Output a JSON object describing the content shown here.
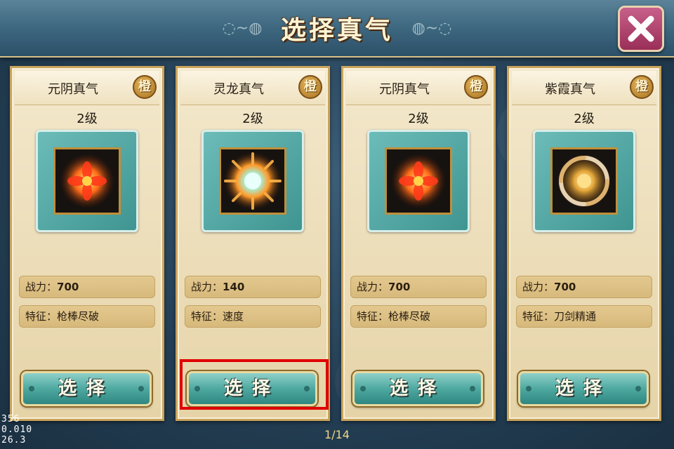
{
  "header": {
    "title": "选择真气"
  },
  "cards": [
    {
      "name": "元阴真气",
      "quality": "橙",
      "level": "2级",
      "power_label": "战力：",
      "power_value": "700",
      "trait_label": "特征：",
      "trait_value": "枪棒尽破",
      "button_label": "选择",
      "orb": "fire-flower-icon"
    },
    {
      "name": "灵龙真气",
      "quality": "橙",
      "level": "2级",
      "power_label": "战力：",
      "power_value": "140",
      "trait_label": "特征：",
      "trait_value": "速度",
      "button_label": "选择",
      "orb": "burst-orb-icon"
    },
    {
      "name": "元阴真气",
      "quality": "橙",
      "level": "2级",
      "power_label": "战力：",
      "power_value": "700",
      "trait_label": "特征：",
      "trait_value": "枪棒尽破",
      "button_label": "选择",
      "orb": "fire-flower-icon"
    },
    {
      "name": "紫霞真气",
      "quality": "橙",
      "level": "2级",
      "power_label": "战力：",
      "power_value": "700",
      "trait_label": "特征：",
      "trait_value": "刀剑精通",
      "button_label": "选择",
      "orb": "swirl-orb-icon"
    }
  ],
  "pager": {
    "text": "1/14"
  },
  "debug": {
    "line1": "356",
    "line2": "0.010",
    "line3": "26.3"
  },
  "colors": {
    "highlight": "#e00000",
    "accent_gold": "#c9a35c",
    "teal": "#4ea9a1"
  }
}
